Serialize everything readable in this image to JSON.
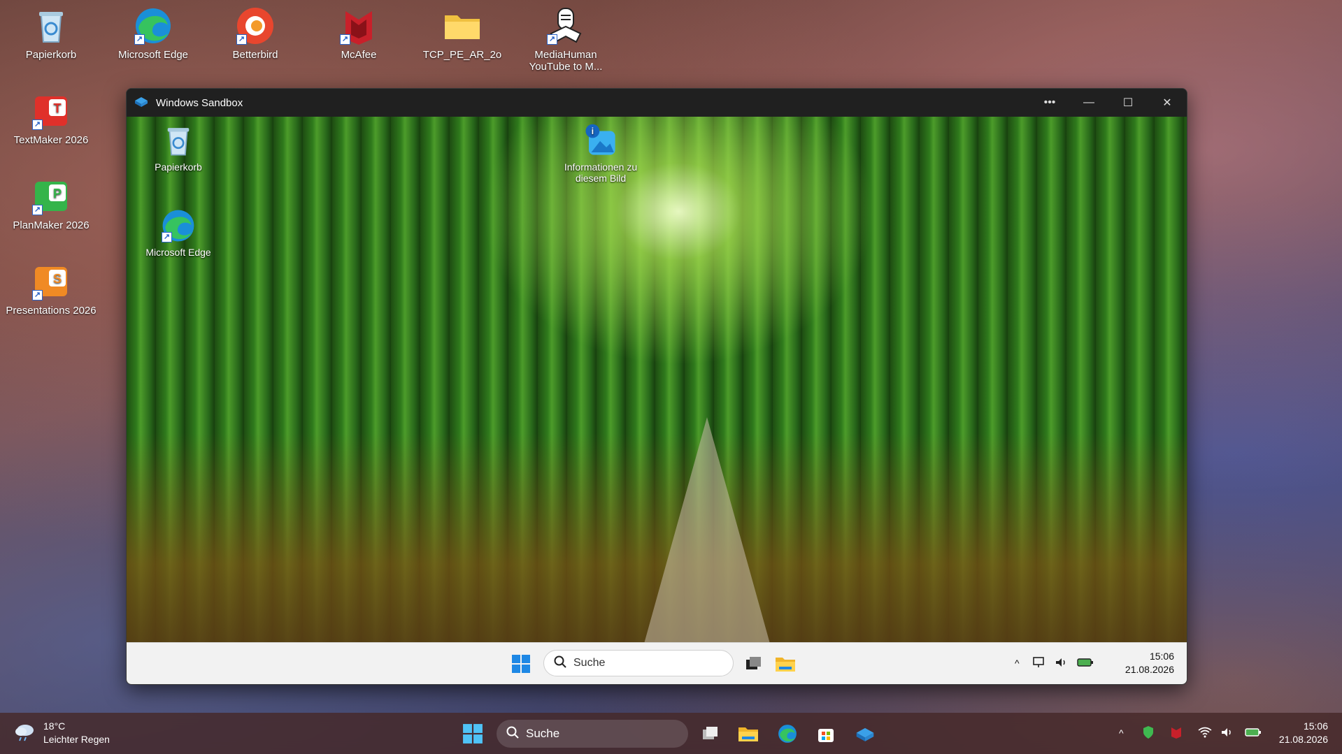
{
  "desktop": {
    "icons": [
      {
        "label": "Papierkorb"
      },
      {
        "label": "Microsoft Edge"
      },
      {
        "label": "Betterbird"
      },
      {
        "label": "McAfee"
      },
      {
        "label": "TCP_PE_AR_2o"
      },
      {
        "label": "MediaHuman YouTube to M..."
      },
      {
        "label": "TextMaker 2026"
      },
      {
        "label": "PlanMaker 2026"
      },
      {
        "label": "Presentations 2026"
      }
    ]
  },
  "sandbox": {
    "title": "Windows Sandbox",
    "more_label": "•••",
    "minimize_label": "—",
    "maximize_label": "☐",
    "close_label": "✕",
    "desktop_icons": [
      {
        "label": "Papierkorb"
      },
      {
        "label": "Microsoft Edge"
      },
      {
        "label": "Informationen zu diesem Bild"
      }
    ],
    "taskbar": {
      "search_placeholder": "Suche",
      "tray_chevron": "^",
      "time": "15:06",
      "date": "21.08.2026"
    }
  },
  "taskbar": {
    "weather": {
      "temp": "18°C",
      "desc": "Leichter Regen"
    },
    "search_placeholder": "Suche",
    "tray_chevron": "^",
    "time": "15:06",
    "date": "21.08.2026"
  }
}
